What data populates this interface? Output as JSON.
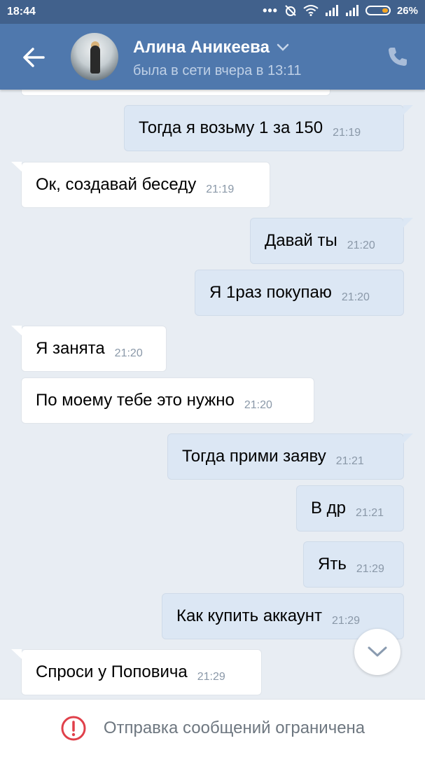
{
  "status_bar": {
    "time": "18:44",
    "battery_percent": "26%"
  },
  "header": {
    "contact_name": "Алина Аникеева",
    "last_seen": "была в сети вчера в 13:11"
  },
  "messages": [
    {
      "dir": "out",
      "text": "Тогда я возьму 1 за 150",
      "time": "21:19"
    },
    {
      "dir": "in",
      "text": "Ок, создавай беседу",
      "time": "21:19"
    },
    {
      "dir": "out",
      "text": "Давай ты",
      "time": "21:20"
    },
    {
      "dir": "out",
      "text": "Я 1раз покупаю",
      "time": "21:20"
    },
    {
      "dir": "in",
      "text": "Я занята",
      "time": "21:20"
    },
    {
      "dir": "in",
      "text": "По моему тебе это нужно",
      "time": "21:20"
    },
    {
      "dir": "out",
      "text": "Тогда прими заяву",
      "time": "21:21"
    },
    {
      "dir": "out",
      "text": "В др",
      "time": "21:21"
    },
    {
      "dir": "out",
      "text": "Ять",
      "time": "21:29"
    },
    {
      "dir": "out",
      "text": "Как купить аккаунт",
      "time": "21:29"
    },
    {
      "dir": "in",
      "text": "Спроси у Поповича",
      "time": "21:29"
    }
  ],
  "footer": {
    "restriction_text": "Отправка сообщений ограничена"
  },
  "colors": {
    "header": "#4f78ad",
    "status_bar": "#41618c",
    "outgoing_bubble": "#dce7f4",
    "incoming_bubble": "#ffffff",
    "warning": "#e0404a"
  }
}
